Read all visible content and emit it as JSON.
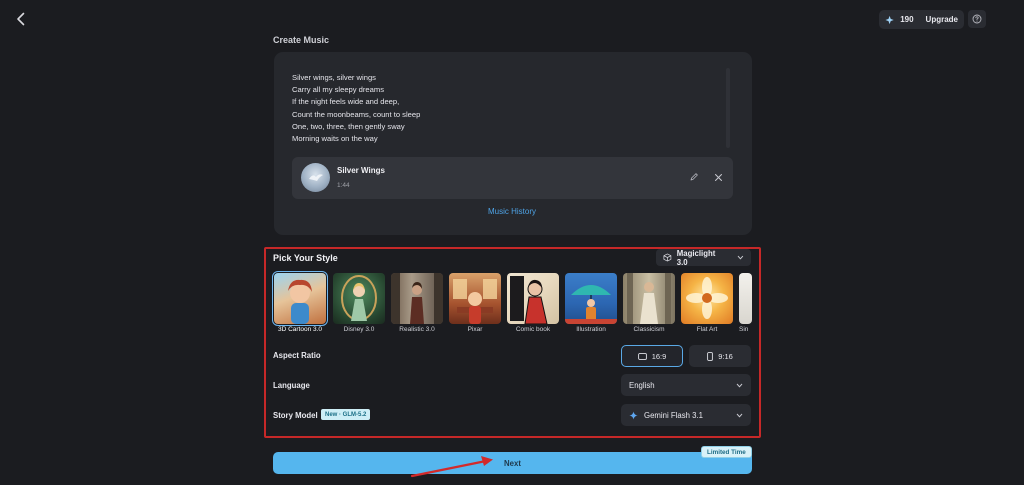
{
  "header": {
    "credits": "190",
    "upgrade_label": "Upgrade"
  },
  "create_music": {
    "title": "Create Music",
    "lyrics": [
      "Silver wings, silver wings",
      "Carry all my sleepy dreams",
      "If the night feels wide and deep,",
      "Count the moonbeams, count to sleep",
      "One, two, three, then gently sway",
      "Morning waits on the way"
    ],
    "song": {
      "title": "Silver Wings",
      "duration": "1:44"
    },
    "history_label": "Music History"
  },
  "style": {
    "title": "Pick Your Style",
    "model": "Magiclight 3.0",
    "selected": "3D Cartoon 3.0",
    "items": [
      {
        "label": "3D Cartoon 3.0"
      },
      {
        "label": "Disney 3.0"
      },
      {
        "label": "Realistic 3.0"
      },
      {
        "label": "Pixar"
      },
      {
        "label": "Comic book"
      },
      {
        "label": "Illustration"
      },
      {
        "label": "Classicism"
      },
      {
        "label": "Flat Art"
      },
      {
        "label": "Sin"
      }
    ]
  },
  "aspect_ratio": {
    "label": "Aspect Ratio",
    "options": [
      "16:9",
      "9:16"
    ],
    "selected": "16:9"
  },
  "language": {
    "label": "Language",
    "value": "English"
  },
  "story_model": {
    "label": "Story Model",
    "badge": "New · GLM-5.2",
    "value": "Gemini Flash 3.1"
  },
  "next": {
    "label": "Next",
    "badge": "Limited Time"
  },
  "colors": {
    "accent": "#55b6ee",
    "highlight_box": "#c62828",
    "background": "#1b1c20"
  }
}
